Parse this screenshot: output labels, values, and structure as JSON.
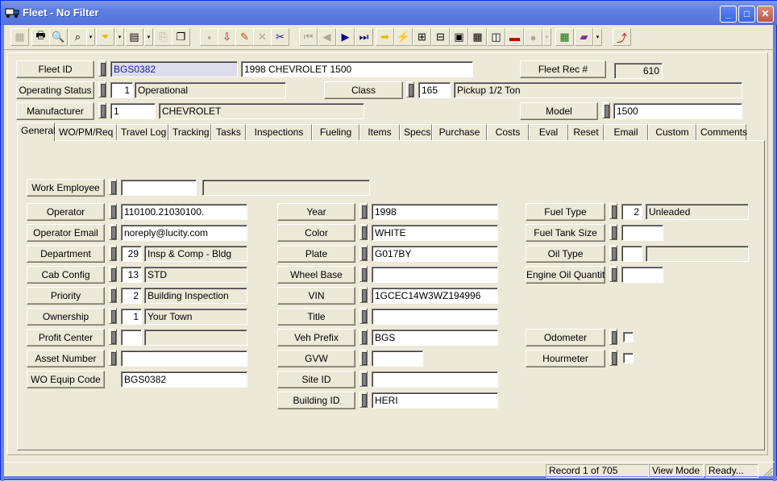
{
  "window": {
    "title": "Fleet - No Filter",
    "minimize": "_",
    "maximize": "□",
    "close": "✕"
  },
  "toolbar": {
    "buttons": [
      {
        "name": "grid-view-icon",
        "glyph": "▦",
        "disabled": true
      },
      {
        "name": "print-icon",
        "glyph": "🖶"
      },
      {
        "name": "print-preview-icon",
        "glyph": "🔍"
      },
      {
        "name": "find-icon",
        "glyph": "⌕"
      },
      {
        "name": "find-dropdown",
        "glyph": "▾",
        "dropdown": true
      },
      {
        "name": "filter-icon",
        "glyph": "⏷"
      },
      {
        "name": "filter-dropdown",
        "glyph": "▾",
        "dropdown": true
      },
      {
        "name": "report-icon",
        "glyph": "▤"
      },
      {
        "name": "report-dropdown",
        "glyph": "▾",
        "dropdown": true
      },
      {
        "name": "export-icon",
        "glyph": "⎘",
        "disabled": true
      },
      {
        "name": "document-icon",
        "glyph": "❐"
      },
      {
        "name": "save-icon",
        "glyph": "▪",
        "disabled": true
      },
      {
        "name": "add-record-icon",
        "glyph": "⇩"
      },
      {
        "name": "edit-pencil-icon",
        "glyph": "✎"
      },
      {
        "name": "delete-icon",
        "glyph": "✕",
        "disabled": true
      },
      {
        "name": "cut-icon",
        "glyph": "✂"
      },
      {
        "name": "first-record-icon",
        "glyph": "⏮",
        "disabled": true
      },
      {
        "name": "previous-record-icon",
        "glyph": "◀",
        "disabled": true
      },
      {
        "name": "next-record-icon",
        "glyph": "▶"
      },
      {
        "name": "last-record-icon",
        "glyph": "⏭"
      },
      {
        "name": "go-arrow-icon",
        "glyph": "➡"
      },
      {
        "name": "lightning-icon",
        "glyph": "⚡"
      },
      {
        "name": "hierarchy-icon",
        "glyph": "⊞"
      },
      {
        "name": "relationship-icon",
        "glyph": "⊟"
      },
      {
        "name": "equipment-icon",
        "glyph": "▣"
      },
      {
        "name": "calculator-icon",
        "glyph": "▦"
      },
      {
        "name": "map-icon",
        "glyph": "◫"
      },
      {
        "name": "toolbox-icon",
        "glyph": "▬"
      },
      {
        "name": "help-bubble-icon",
        "glyph": "●",
        "disabled": true
      },
      {
        "name": "help-dropdown",
        "glyph": "▾",
        "dropdown": true,
        "disabled": true
      },
      {
        "name": "spreadsheet-icon",
        "glyph": "▦"
      },
      {
        "name": "book-icon",
        "glyph": "▰"
      },
      {
        "name": "book-dropdown",
        "glyph": "▾",
        "dropdown": true
      },
      {
        "name": "exit-icon",
        "glyph": "⤴"
      }
    ]
  },
  "header": {
    "fleet_id_label": "Fleet ID",
    "fleet_id_value": "BGS0382",
    "fleet_description": "1998 CHEVROLET 1500",
    "fleet_rec_label": "Fleet Rec #",
    "fleet_rec_value": "610",
    "operating_status_label": "Operating Status",
    "operating_status_code": "1",
    "operating_status_desc": "Operational",
    "class_label": "Class",
    "class_code": "165",
    "class_desc": "Pickup 1/2 Ton",
    "manufacturer_label": "Manufacturer",
    "manufacturer_code": "1",
    "manufacturer_desc": "CHEVROLET",
    "model_label": "Model",
    "model_value": "1500"
  },
  "tabs": [
    {
      "label": "General",
      "active": true
    },
    {
      "label": "WO/PM/Req"
    },
    {
      "label": "Travel Log"
    },
    {
      "label": "Tracking"
    },
    {
      "label": "Tasks"
    },
    {
      "label": "Inspections"
    },
    {
      "label": "Fueling"
    },
    {
      "label": "Items"
    },
    {
      "label": "Specs"
    },
    {
      "label": "Purchase"
    },
    {
      "label": "Costs"
    },
    {
      "label": "Eval"
    },
    {
      "label": "Reset"
    },
    {
      "label": "Email"
    },
    {
      "label": "Custom"
    },
    {
      "label": "Comments"
    }
  ],
  "general": {
    "work_employee": {
      "label": "Work Employee",
      "code": "",
      "desc": ""
    },
    "left": [
      {
        "label": "Operator",
        "value": "110100.21030100."
      },
      {
        "label": "Operator Email",
        "value": "noreply@lucity.com"
      },
      {
        "label": "Department",
        "code": "29",
        "desc": "Insp & Comp - Bldg"
      },
      {
        "label": "Cab Config",
        "code": "13",
        "desc": "STD"
      },
      {
        "label": "Priority",
        "code": "2",
        "desc": "Building Inspection"
      },
      {
        "label": "Ownership",
        "code": "1",
        "desc": "Your Town"
      },
      {
        "label": "Profit Center",
        "code": "",
        "desc": ""
      },
      {
        "label": "Asset Number",
        "value": ""
      },
      {
        "label": "WO Equip Code",
        "value": "BGS0382"
      }
    ],
    "middle": [
      {
        "label": "Year",
        "value": "1998"
      },
      {
        "label": "Color",
        "value": "WHITE"
      },
      {
        "label": "Plate",
        "value": "G017BY"
      },
      {
        "label": "Wheel Base",
        "value": ""
      },
      {
        "label": "VIN",
        "value": "1GCEC14W3WZ194996"
      },
      {
        "label": "Title",
        "value": ""
      },
      {
        "label": "Veh Prefix",
        "value": "BGS"
      },
      {
        "label": "GVW",
        "value": ""
      },
      {
        "label": "Site ID",
        "value": ""
      },
      {
        "label": "Building ID",
        "value": "HERI"
      }
    ],
    "right": [
      {
        "label": "Fuel Type",
        "code": "2",
        "desc": "Unleaded"
      },
      {
        "label": "Fuel Tank Size",
        "value": ""
      },
      {
        "label": "Oil Type",
        "code": "",
        "desc": ""
      },
      {
        "label": "Engine Oil Quantity",
        "value": ""
      }
    ],
    "meters": [
      {
        "label": "Odometer",
        "checked": false
      },
      {
        "label": "Hourmeter",
        "checked": false
      }
    ]
  },
  "status": {
    "record": "Record 1 of 705",
    "mode": "View Mode",
    "state": "Ready..."
  }
}
